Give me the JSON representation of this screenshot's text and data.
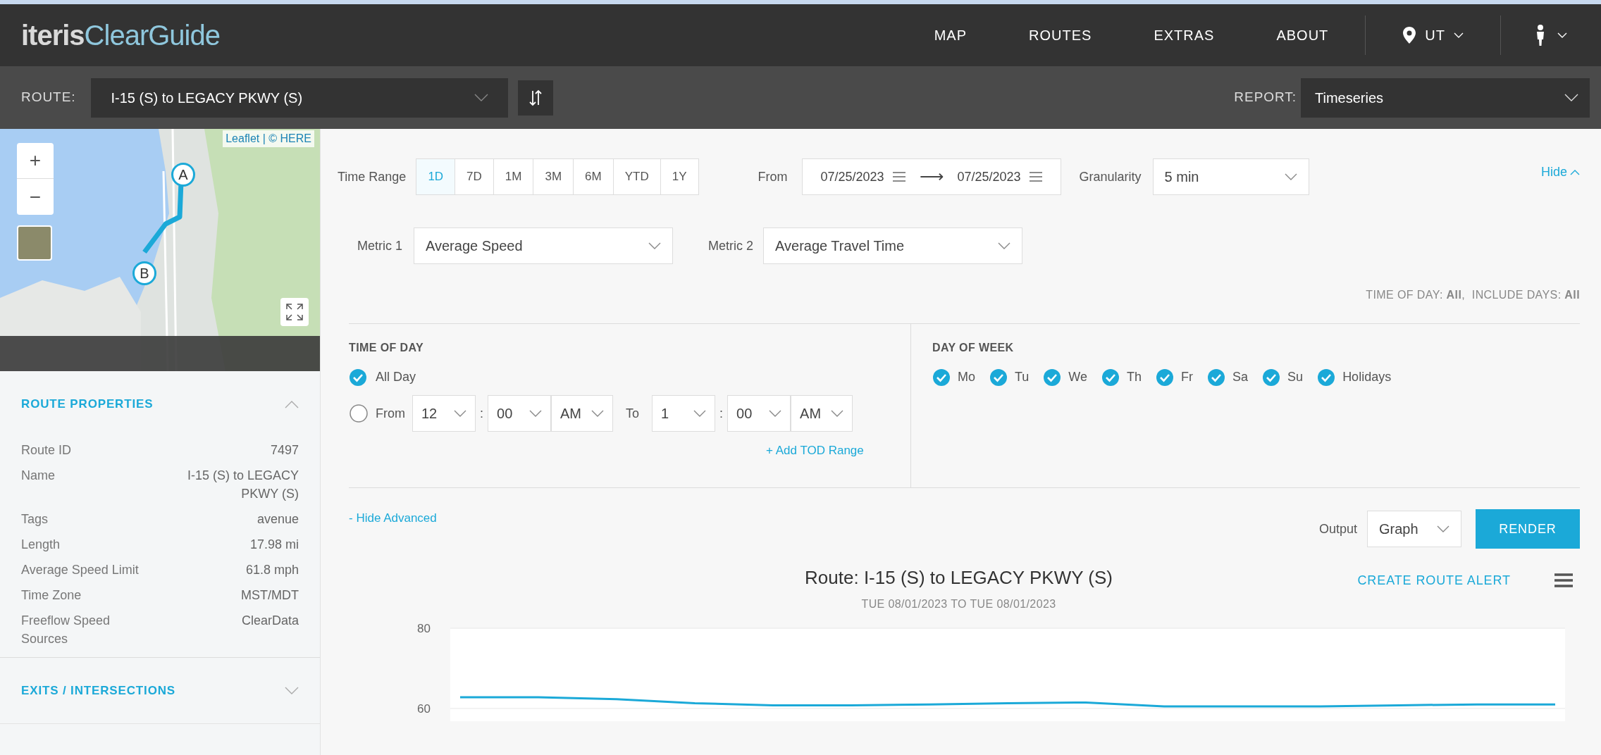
{
  "header": {
    "logo": {
      "brand": "iteris",
      "product": "ClearGuide"
    },
    "nav": [
      {
        "label": "MAP"
      },
      {
        "label": "ROUTES"
      },
      {
        "label": "EXTRAS"
      },
      {
        "label": "ABOUT"
      }
    ],
    "region": "UT"
  },
  "route_bar": {
    "route_label": "ROUTE:",
    "route": "I-15 (S) to LEGACY PKWY (S)",
    "report_label": "REPORT:",
    "report": "Timeseries"
  },
  "map": {
    "attribution": "Leaflet | © HERE",
    "zoom_in": "+",
    "zoom_out": "−",
    "markers": [
      {
        "label": "A"
      },
      {
        "label": "B"
      }
    ]
  },
  "sidebar": {
    "sections": [
      {
        "title": "ROUTE PROPERTIES",
        "expanded": true,
        "properties": [
          {
            "name": "Route ID",
            "value": "7497"
          },
          {
            "name": "Name",
            "value": "I-15 (S) to LEGACY PKWY (S)"
          },
          {
            "name": "Tags",
            "value": "avenue"
          },
          {
            "name": "Length",
            "value": "17.98 mi"
          },
          {
            "name": "Average Speed Limit",
            "value": "61.8 mph"
          },
          {
            "name": "Time Zone",
            "value": "MST/MDT"
          },
          {
            "name": "Freeflow Speed Sources",
            "value": "ClearData"
          }
        ]
      },
      {
        "title": "EXITS / INTERSECTIONS",
        "expanded": false
      }
    ]
  },
  "filters": {
    "time_range_label": "Time Range",
    "time_ranges": [
      {
        "label": "1D",
        "selected": true
      },
      {
        "label": "7D",
        "selected": false
      },
      {
        "label": "1M",
        "selected": false
      },
      {
        "label": "3M",
        "selected": false
      },
      {
        "label": "6M",
        "selected": false
      },
      {
        "label": "YTD",
        "selected": false
      },
      {
        "label": "1Y",
        "selected": false
      }
    ],
    "from_label": "From",
    "start_date": "07/25/2023",
    "arrow": "⟶",
    "end_date": "07/25/2023",
    "granularity_label": "Granularity",
    "granularity": "5 min",
    "hide": "Hide",
    "metric1_label": "Metric 1",
    "metric1": "Average Speed",
    "metric2_label": "Metric 2",
    "metric2": "Average Travel Time",
    "summary": "TIME OF DAY: **All**,  INCLUDE DAYS: **All**"
  },
  "time_of_day": {
    "title": "TIME OF DAY",
    "all_day": {
      "label": "All Day",
      "checked": true
    },
    "custom_range": {
      "selected": false,
      "from_label": "From",
      "from_hour": "12",
      "from_separator": ":",
      "from_minute": "00",
      "from_period": "AM",
      "to_label": "To",
      "to_hour": "1",
      "to_separator": ":",
      "to_minute": "00",
      "to_period": "AM"
    },
    "add_link": "+ Add TOD Range"
  },
  "day_of_week": {
    "title": "DAY OF WEEK",
    "days": [
      {
        "label": "Mo",
        "checked": true
      },
      {
        "label": "Tu",
        "checked": true
      },
      {
        "label": "We",
        "checked": true
      },
      {
        "label": "Th",
        "checked": true
      },
      {
        "label": "Fr",
        "checked": true
      },
      {
        "label": "Sa",
        "checked": true
      },
      {
        "label": "Su",
        "checked": true
      },
      {
        "label": "Holidays",
        "checked": true
      }
    ]
  },
  "actions": {
    "hide_advanced": "- Hide Advanced",
    "output_label": "Output",
    "output": "Graph",
    "render": "RENDER"
  },
  "chart": {
    "title": "Route: I-15 (S) to LEGACY PKWY (S)",
    "subtitle": "TUE 08/01/2023 TO TUE 08/01/2023",
    "alert_link": "CREATE ROUTE ALERT",
    "chart_data": {
      "type": "line",
      "ylim": [
        57,
        80
      ],
      "yticks": [
        60,
        80
      ],
      "series": [
        {
          "color": "#1ba9d8",
          "values": [
            62.8,
            62.8,
            62.3,
            61.3,
            60.8,
            60.8,
            61.0,
            61.3,
            61.5,
            60.5,
            60.5,
            60.5,
            60.8,
            61.0,
            61.0
          ]
        }
      ]
    }
  }
}
